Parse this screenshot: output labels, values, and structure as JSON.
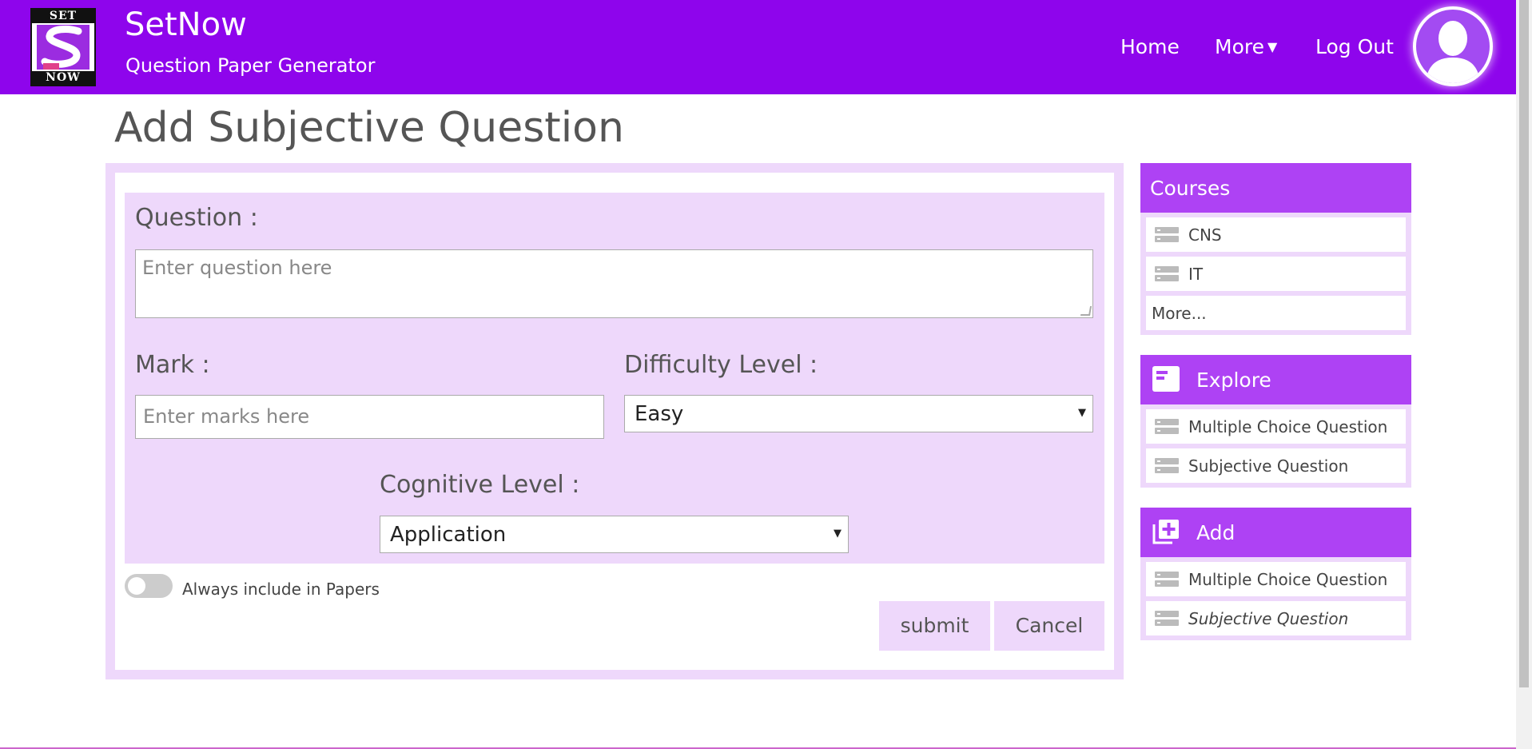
{
  "header": {
    "logo_top": "SET",
    "logo_bottom": "NOW",
    "app_title": "SetNow",
    "app_subtitle": "Question Paper Generator",
    "nav": {
      "home": "Home",
      "more": "More",
      "logout": "Log Out"
    },
    "accent_color": "#8e05ec"
  },
  "page": {
    "title": "Add Subjective Question"
  },
  "form": {
    "question_label": "Question :",
    "question_placeholder": "Enter question here",
    "mark_label": "Mark :",
    "mark_placeholder": "Enter marks here",
    "difficulty_label": "Difficulty Level :",
    "difficulty_value": "Easy",
    "cognitive_label": "Cognitive Level :",
    "cognitive_value": "Application",
    "toggle_label": "Always include in Papers",
    "toggle_on": false,
    "submit_label": "submit",
    "cancel_label": "Cancel"
  },
  "sidebar": {
    "courses": {
      "title": "Courses",
      "items": [
        "CNS",
        "IT"
      ],
      "more": "More..."
    },
    "explore": {
      "title": "Explore",
      "items": [
        "Multiple Choice Question",
        "Subjective Question"
      ]
    },
    "add": {
      "title": "Add",
      "items": [
        "Multiple Choice Question",
        "Subjective Question"
      ]
    }
  }
}
